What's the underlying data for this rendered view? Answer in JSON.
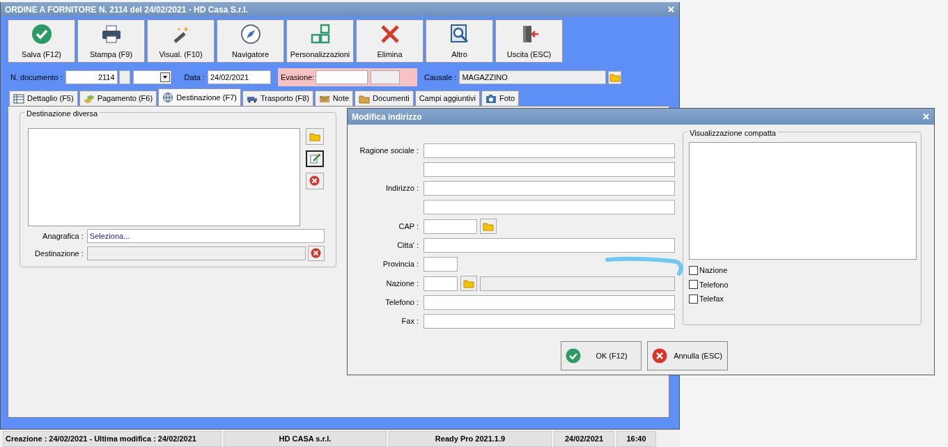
{
  "window": {
    "title": "ORDINE A FORNITORE N. 2114 del 24/02/2021 - HD Casa S.r.l."
  },
  "toolbar": [
    {
      "label": "Salva (F12)"
    },
    {
      "label": "Stampa (F9)"
    },
    {
      "label": "Visual. (F10)"
    },
    {
      "label": "Navigatore"
    },
    {
      "label": "Personalizzazioni"
    },
    {
      "label": "Elimina"
    },
    {
      "label": "Altro"
    },
    {
      "label": "Uscita (ESC)"
    }
  ],
  "header": {
    "document_label": "N. documento :",
    "document_number": "2114",
    "date_label": "Data :",
    "date": "24/02/2021",
    "evasione_label": "Evasione:",
    "causale_label": "Causale :",
    "causale": "MAGAZZINO"
  },
  "tabs": [
    {
      "label": "Dettaglio (F5)",
      "selected": false
    },
    {
      "label": "Pagamento (F6)",
      "selected": false
    },
    {
      "label": "Destinazione (F7)",
      "selected": true
    },
    {
      "label": "Trasporto (F8)",
      "selected": false
    },
    {
      "label": "Note",
      "selected": false
    },
    {
      "label": "Documenti",
      "selected": false
    },
    {
      "label": "Campi aggiuntivi",
      "selected": false
    },
    {
      "label": "Foto",
      "selected": false
    }
  ],
  "destinazione_diversa": {
    "title": "Destinazione diversa",
    "anagrafica_label": "Anagrafica :",
    "anagrafica_value": "Seleziona...",
    "destinazione_label": "Destinazione :"
  },
  "dialog": {
    "title": "Modifica indirizzo",
    "fields": [
      {
        "label": "Ragione sociale :",
        "kind": "wide"
      },
      {
        "kind": "wide"
      },
      {
        "label": "Indirizzo :",
        "kind": "wide"
      },
      {
        "kind": "wide"
      },
      {
        "label": "CAP :",
        "kind": "cap"
      },
      {
        "label": "Citta' :",
        "kind": "wide"
      },
      {
        "label": "Provincia :",
        "kind": "short"
      },
      {
        "label": "Nazione :",
        "kind": "lookup"
      },
      {
        "label": "Telefono :",
        "kind": "wide"
      },
      {
        "label": "Fax :",
        "kind": "wide"
      }
    ],
    "compact_title": "Visualizzazione compatta",
    "checkboxes": [
      {
        "label": "Nazione",
        "checked": false
      },
      {
        "label": "Telefono",
        "checked": false
      },
      {
        "label": "Telefax",
        "checked": false
      }
    ],
    "buttons": [
      {
        "label": "OK (F12)",
        "kind": "ok"
      },
      {
        "label": "Annulla (ESC)",
        "kind": "cancel"
      }
    ]
  },
  "status_bar": [
    "Creazione : 24/02/2021 - Ultima modifica : 24/02/2021",
    "HD CASA s.r.l.",
    "Ready Pro 2021.1.9",
    "24/02/2021",
    "16:40"
  ]
}
